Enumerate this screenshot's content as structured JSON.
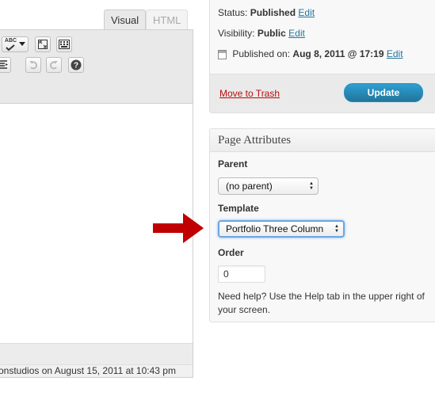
{
  "editor": {
    "tabs": [
      {
        "label": "Visual",
        "active": true
      },
      {
        "label": "HTML",
        "active": false
      }
    ],
    "toolbar_icons": [
      "spellcheck-icon",
      "fullscreen-icon",
      "kitchen-sink-icon",
      "indent-icon",
      "undo-icon",
      "redo-icon",
      "help-icon"
    ],
    "spellcheck_label": "ABC",
    "last_edited": "onstudios on August 15, 2011 at 10:43 pm"
  },
  "publish": {
    "status_label": "Status:",
    "status_value": "Published",
    "visibility_label": "Visibility:",
    "visibility_value": "Public",
    "published_label": "Published on:",
    "published_value": "Aug 8, 2011 @ 17:19",
    "edit_link": "Edit",
    "trash_label": "Move to Trash",
    "update_label": "Update"
  },
  "page_attributes": {
    "title": "Page Attributes",
    "parent_label": "Parent",
    "parent_value": "(no parent)",
    "template_label": "Template",
    "template_value": "Portfolio Three Column",
    "order_label": "Order",
    "order_value": "0",
    "help_text": "Need help? Use the Help tab in the upper right of your screen."
  },
  "colors": {
    "arrow": "#c00000",
    "link": "#21759b",
    "trash": "#bc0b0b",
    "update_button": "#21759b"
  }
}
